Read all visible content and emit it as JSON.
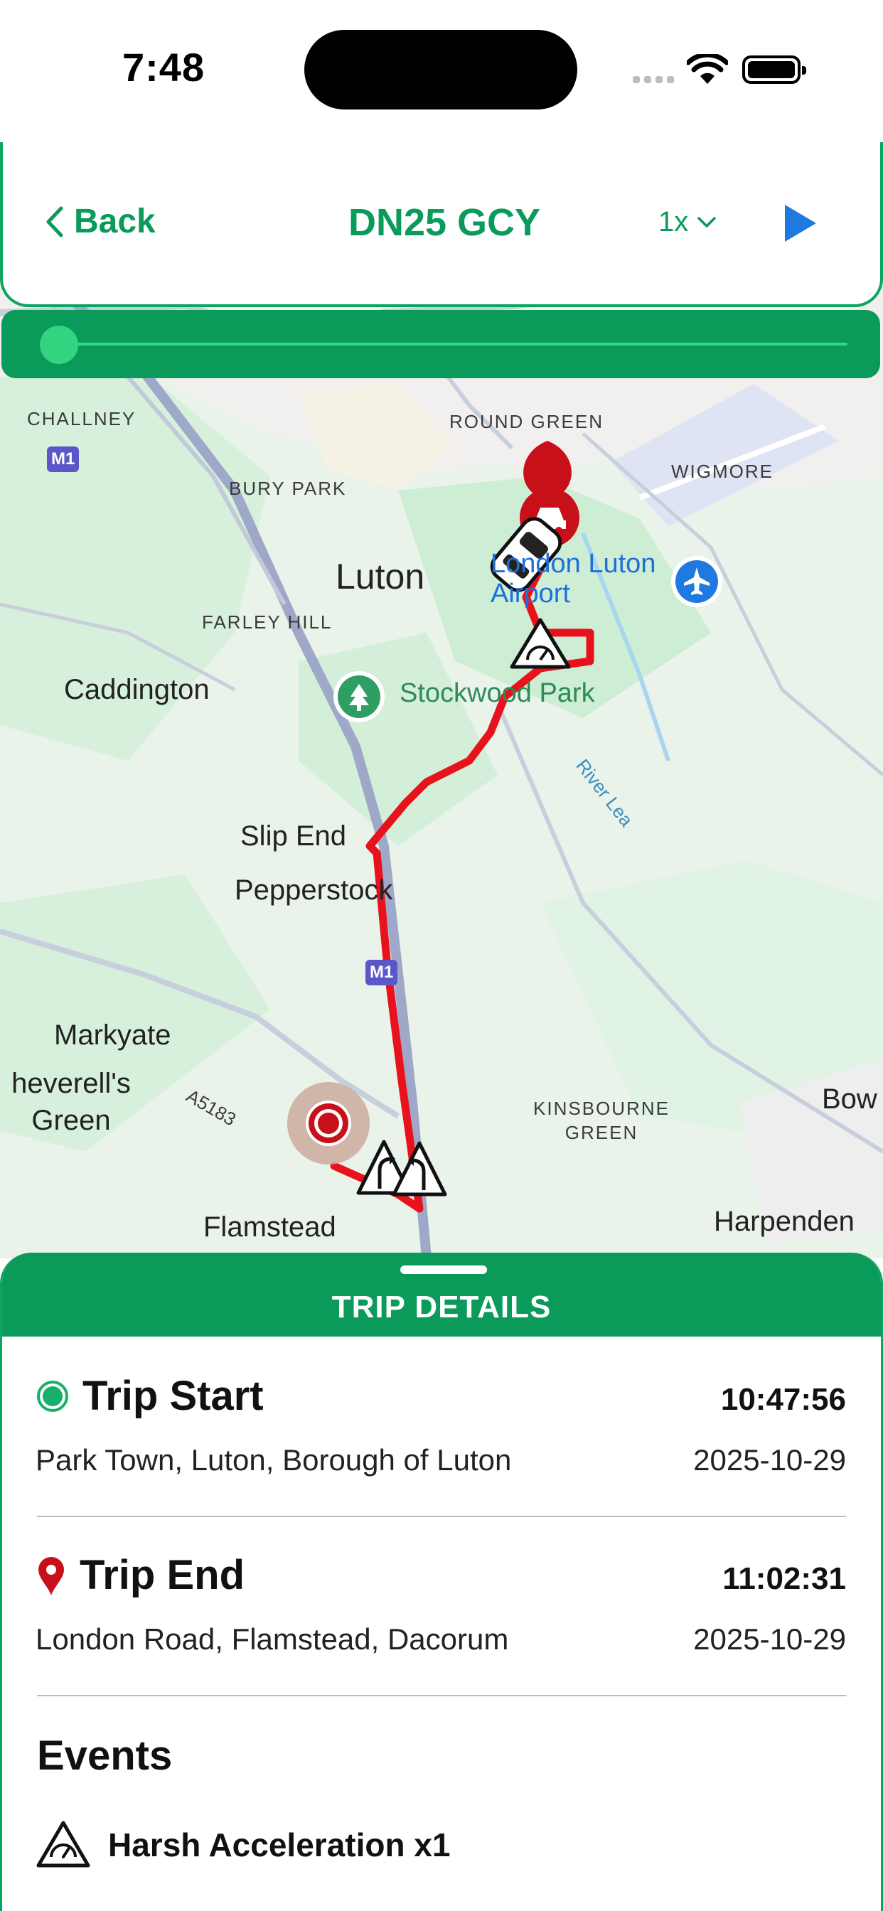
{
  "status_bar": {
    "time": "7:48"
  },
  "header": {
    "back_label": "Back",
    "title": "DN25 GCY",
    "speed": "1x"
  },
  "playback": {
    "progress": 0.0
  },
  "map": {
    "labels": {
      "challney": "CHALLNEY",
      "round_green": "ROUND GREEN",
      "bury_park": "BURY PARK",
      "wigmore": "WIGMORE",
      "luton": "Luton",
      "farley_hill": "FARLEY HILL",
      "london_airport": "London Luton Airport",
      "caddington": "Caddington",
      "stockwood_park": "Stockwood Park",
      "river_lea": "River Lea",
      "slip_end": "Slip End",
      "pepperstock": "Pepperstock",
      "markyate": "Markyate",
      "peverells_green": "heverell's Green",
      "kinsbourne_green": "KINSBOURNE GREEN",
      "bow": "Bow",
      "flamstead": "Flamstead",
      "harpenden": "Harpenden",
      "a5183": "A5183",
      "m1": "M1"
    },
    "route_color": "#e8121c",
    "park_color": "#cdeed4",
    "urban_color": "#f1f0ee"
  },
  "sheet": {
    "title": "TRIP DETAILS",
    "trip_start": {
      "label": "Trip Start",
      "time": "10:47:56",
      "address": "Park Town, Luton, Borough of Luton",
      "date": "2025-10-29"
    },
    "trip_end": {
      "label": "Trip End",
      "time": "11:02:31",
      "address": "London Road, Flamstead, Dacorum",
      "date": "2025-10-29"
    },
    "events_title": "Events",
    "events": [
      {
        "label": "Harsh Acceleration x1",
        "icon": "speedometer-warning-icon"
      }
    ]
  },
  "colors": {
    "brand_green": "#0a9a5a",
    "accent_blue": "#1f7ae0",
    "end_red": "#c8101a"
  }
}
